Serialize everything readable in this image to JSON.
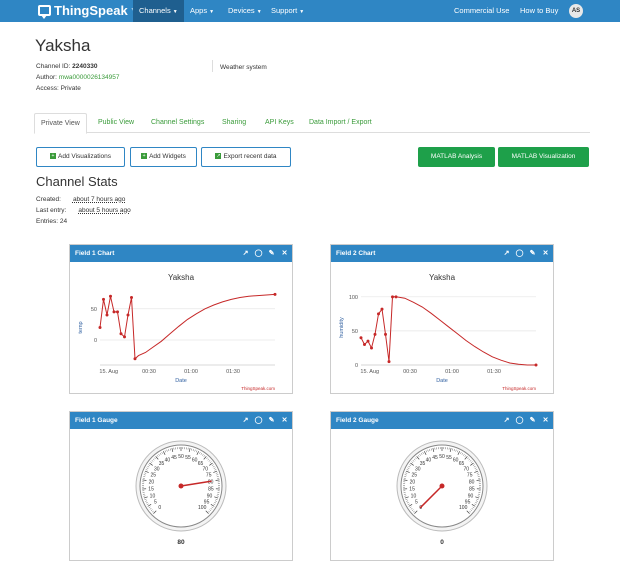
{
  "nav": {
    "brand": "ThingSpeak",
    "brand_tm": "™",
    "items": [
      {
        "label": "Channels",
        "active": true
      },
      {
        "label": "Apps"
      },
      {
        "label": "Devices"
      },
      {
        "label": "Support"
      }
    ],
    "right_items": [
      "Commercial Use",
      "How to Buy"
    ],
    "avatar": "AS"
  },
  "channel": {
    "title": "Yaksha",
    "id_label": "Channel ID:",
    "id_value": "2240330",
    "author_label": "Author:",
    "author_value": "mwa0000026134957",
    "access_label": "Access:",
    "access_value": "Private",
    "description": "Weather system"
  },
  "tabs": [
    "Private View",
    "Public View",
    "Channel Settings",
    "Sharing",
    "API Keys",
    "Data Import / Export"
  ],
  "buttons": {
    "add_visualizations": "Add Visualizations",
    "add_widgets": "Add Widgets",
    "export_recent": "Export recent data",
    "matlab_analysis": "MATLAB Analysis",
    "matlab_visualization": "MATLAB Visualization"
  },
  "stats": {
    "title": "Channel Stats",
    "created_label": "Created:",
    "created_value": "about 7 hours ago",
    "last_entry_label": "Last entry:",
    "last_entry_value": "about 5 hours ago",
    "entries_label": "Entries:",
    "entries_value": "24"
  },
  "panels": {
    "field1_chart": "Field 1 Chart",
    "field2_chart": "Field 2 Chart",
    "field1_gauge": "Field 1 Gauge",
    "field2_gauge": "Field 2 Gauge"
  },
  "icons": [
    "external-link-icon",
    "comment-icon",
    "pencil-icon",
    "close-icon"
  ],
  "colors": {
    "nav": "#2f86c4",
    "accent_green": "#1ea04a",
    "link_green": "#3a9b3a",
    "series": "#c62828"
  },
  "chart_data": [
    {
      "type": "line",
      "title": "Yaksha",
      "xlabel": "Date",
      "ylabel": "temp",
      "x_ticks": [
        "15. Aug",
        "00:30",
        "01:00",
        "01:30"
      ],
      "y_ticks": [
        0,
        50
      ],
      "ylim": [
        -40,
        80
      ],
      "credit": "ThingSpeak.com",
      "series": [
        {
          "x": [
            0.0,
            0.02,
            0.04,
            0.06,
            0.08,
            0.1,
            0.12,
            0.14,
            0.16,
            0.18,
            0.2,
            0.22,
            0.26,
            0.3,
            0.35,
            0.4,
            0.45,
            0.5,
            0.55,
            0.6,
            0.65,
            0.7,
            0.75,
            0.8,
            0.85,
            0.9,
            0.95,
            1.0
          ],
          "values": [
            20,
            65,
            40,
            70,
            45,
            45,
            10,
            5,
            40,
            68,
            -30,
            -25,
            -20,
            -12,
            -2,
            10,
            22,
            33,
            42,
            50,
            56,
            61,
            65,
            68,
            70,
            71,
            72,
            73
          ]
        }
      ]
    },
    {
      "type": "line",
      "title": "Yaksha",
      "xlabel": "Date",
      "ylabel": "humidity",
      "x_ticks": [
        "15. Aug",
        "00:30",
        "01:00",
        "01:30"
      ],
      "y_ticks": [
        0,
        50,
        100
      ],
      "ylim": [
        0,
        110
      ],
      "credit": "ThingSpeak.com",
      "series": [
        {
          "x": [
            0.0,
            0.02,
            0.04,
            0.06,
            0.08,
            0.1,
            0.12,
            0.14,
            0.16,
            0.18,
            0.2,
            0.25,
            0.3,
            0.35,
            0.4,
            0.45,
            0.5,
            0.55,
            0.6,
            0.65,
            0.7,
            0.75,
            0.8,
            0.85,
            0.9,
            0.95,
            1.0
          ],
          "values": [
            40,
            30,
            35,
            25,
            45,
            75,
            82,
            45,
            5,
            100,
            100,
            98,
            92,
            85,
            76,
            66,
            56,
            46,
            36,
            27,
            19,
            12,
            7,
            3,
            1,
            0,
            0
          ]
        }
      ]
    },
    {
      "type": "gauge",
      "min": 0,
      "max": 100,
      "ticks": [
        0,
        5,
        10,
        15,
        20,
        25,
        30,
        35,
        40,
        45,
        50,
        55,
        60,
        65,
        70,
        75,
        80,
        85,
        90,
        95,
        100
      ],
      "value": 80
    },
    {
      "type": "gauge",
      "min": 0,
      "max": 100,
      "ticks": [
        0,
        5,
        10,
        15,
        20,
        25,
        30,
        35,
        40,
        45,
        50,
        55,
        60,
        65,
        70,
        75,
        80,
        85,
        90,
        95,
        100
      ],
      "value": 0
    }
  ]
}
